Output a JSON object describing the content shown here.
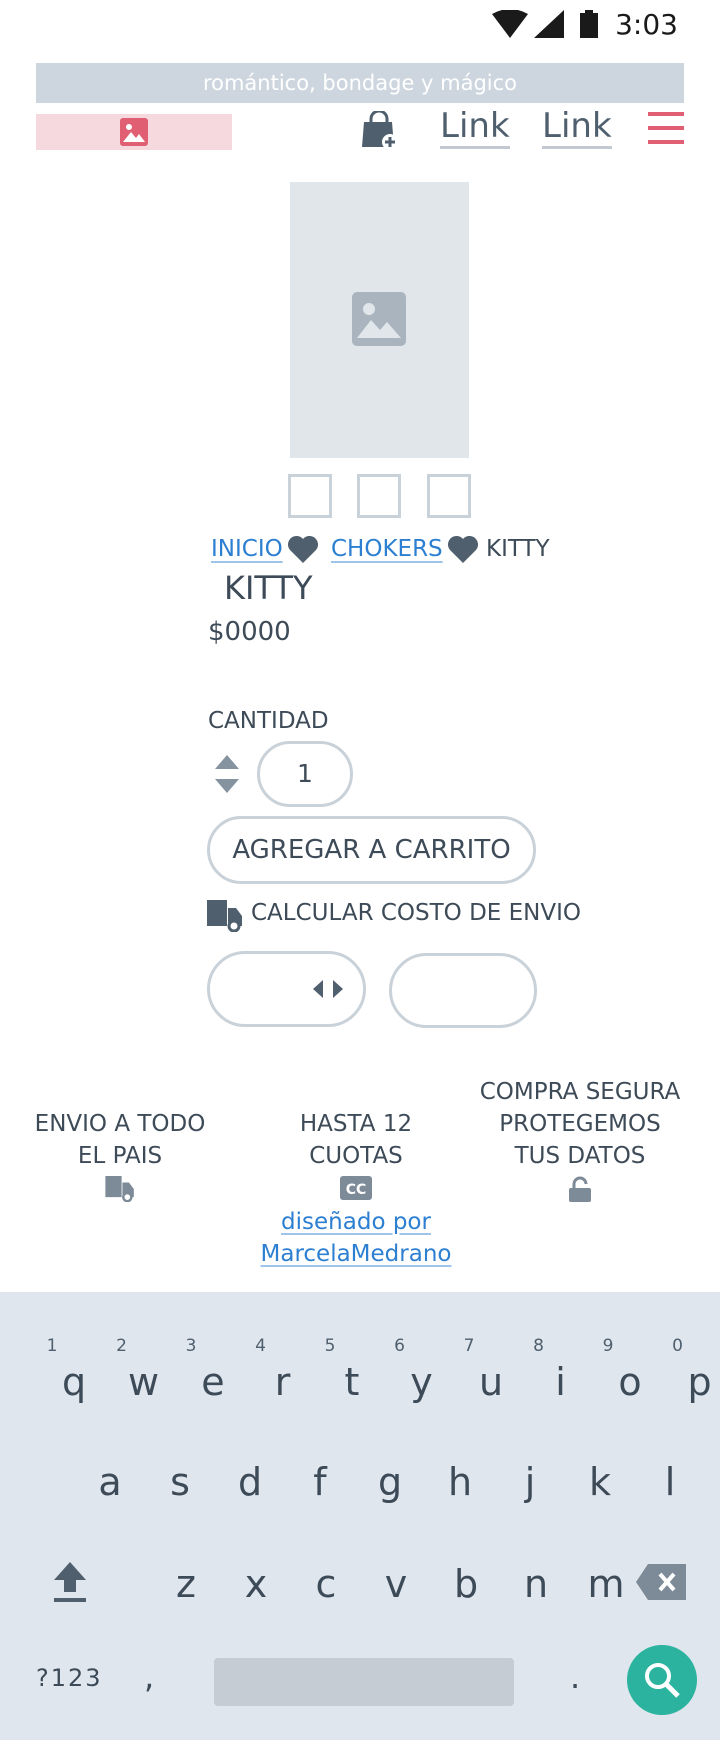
{
  "status_bar": {
    "time": "3:03"
  },
  "announcement": "romántico, bondage y mágico",
  "header": {
    "nav_links": [
      "Link",
      "Link"
    ]
  },
  "breadcrumb": {
    "items": [
      "INICIO",
      "CHOKERS"
    ],
    "current": "KITTY"
  },
  "product": {
    "title": "KITTY",
    "price": "$0000",
    "quantity_label": "CANTIDAD",
    "quantity_value": "1",
    "add_to_cart_label": "AGREGAR A CARRITO",
    "shipping_calc_label": "CALCULAR COSTO DE ENVIO"
  },
  "features": [
    {
      "line1": "ENVIO A TODO",
      "line2": "EL PAIS",
      "line3": "",
      "icon": "truck-icon"
    },
    {
      "line1": "HASTA 12",
      "line2": "CUOTAS",
      "line3": "",
      "icon": "credit-card-icon"
    },
    {
      "line1": "COMPRA SEGURA",
      "line2": "PROTEGEMOS",
      "line3": "TUS DATOS",
      "icon": "lock-icon"
    }
  ],
  "credit": {
    "line1": "diseñado por",
    "line2": "MarcelaMedrano"
  },
  "keyboard": {
    "row1": [
      "q",
      "w",
      "e",
      "r",
      "t",
      "y",
      "u",
      "i",
      "o",
      "p"
    ],
    "row1_hints": [
      "1",
      "2",
      "3",
      "4",
      "5",
      "6",
      "7",
      "8",
      "9",
      "0"
    ],
    "row2": [
      "a",
      "s",
      "d",
      "f",
      "g",
      "h",
      "j",
      "k",
      "l"
    ],
    "row3": [
      "z",
      "x",
      "c",
      "v",
      "b",
      "n",
      "m"
    ],
    "symbols_label": "?123",
    "comma": ",",
    "period": "."
  },
  "colors": {
    "accent_pink": "#e05f73",
    "link_blue": "#2c7fd1",
    "search_teal": "#2bb3a0",
    "keyboard_bg": "#dfe6ee"
  }
}
